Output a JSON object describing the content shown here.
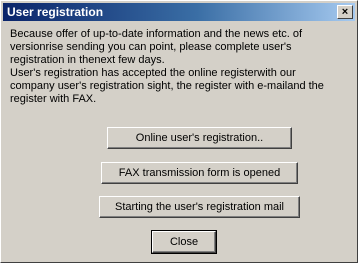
{
  "dialog": {
    "title": "User registration",
    "close_glyph": "×",
    "message_lines": [
      "Because offer of up-to-date information and the news etc. of",
      "versionrise sending you can point, please complete user's",
      "registration in thenext few days.",
      "User's registration has accepted the online registerwith our",
      "company user's registration sight, the register with e-mailand the",
      "register with FAX."
    ],
    "buttons": {
      "online": "Online user's registration..",
      "fax": "FAX transmission form is opened",
      "mail": "Starting the user's registration mail",
      "close": "Close"
    }
  }
}
